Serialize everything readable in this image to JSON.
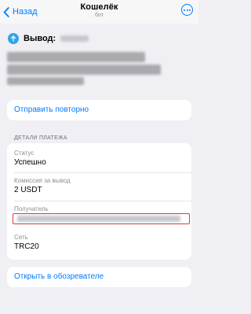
{
  "nav": {
    "back_label": "Назад",
    "title": "Кошелёк",
    "subtitle": "бот"
  },
  "withdraw": {
    "label": "Вывод:"
  },
  "actions": {
    "resend_label": "Отправить повторно",
    "explorer_label": "Открыть в обозревателе"
  },
  "details": {
    "header": "ДЕТАЛИ ПЛАТЕЖА",
    "items": [
      {
        "label": "Статус",
        "value": "Успешно"
      },
      {
        "label": "Комиссия за вывод",
        "value": "2 USDT"
      },
      {
        "label": "Получатель",
        "value": ""
      },
      {
        "label": "Сеть",
        "value": "TRC20"
      }
    ]
  },
  "colors": {
    "accent": "#007aff",
    "highlight": "#e03a3a",
    "coin": "#34a3e7"
  }
}
